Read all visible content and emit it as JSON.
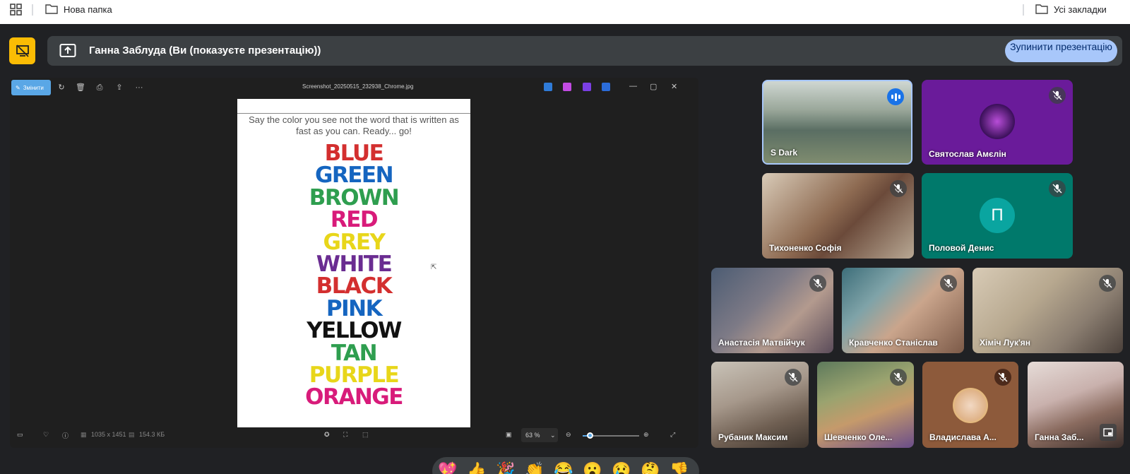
{
  "bookmarks": {
    "folder1": "Нова папка",
    "folder2": "Усі закладки"
  },
  "presentation": {
    "presenter_title": "Ганна Заблуда (Ви (показуєте презентацію))",
    "stop_button": "Зупинити презентацію"
  },
  "viewer": {
    "edit_button": "Змінити",
    "file_name": "Screenshot_20250515_232938_Chrome.jpg",
    "dimensions": "1035 x 1451",
    "file_size": "154.3 КБ",
    "zoom": "63 %",
    "more": "···",
    "minimize": "—",
    "maximize": "▢",
    "close": "✕"
  },
  "document": {
    "instruction": "Say the color you see not the word that is written as fast as you can. Ready... go!",
    "words": [
      {
        "text": "BLUE",
        "color": "#d32f2f"
      },
      {
        "text": "GREEN",
        "color": "#1565c0"
      },
      {
        "text": "BROWN",
        "color": "#2e9e4f"
      },
      {
        "text": "RED",
        "color": "#d81b7a"
      },
      {
        "text": "GREY",
        "color": "#e8d61a"
      },
      {
        "text": "WHITE",
        "color": "#6a2c91"
      },
      {
        "text": "BLACK",
        "color": "#d32f2f"
      },
      {
        "text": "PINK",
        "color": "#1565c0"
      },
      {
        "text": "YELLOW",
        "color": "#111111"
      },
      {
        "text": "TAN",
        "color": "#2e9e4f"
      },
      {
        "text": "PURPLE",
        "color": "#e8d61a"
      },
      {
        "text": "ORANGE",
        "color": "#d81b7a"
      }
    ]
  },
  "participants": [
    {
      "name": "S Dark",
      "muted": false,
      "speaking": true
    },
    {
      "name": "Святослав Амєлін",
      "muted": true
    },
    {
      "name": "Тихоненко Софія",
      "muted": true
    },
    {
      "name": "Половой Денис",
      "muted": true,
      "initial": "П"
    },
    {
      "name": "Анастасія Матвійчук",
      "muted": true
    },
    {
      "name": "Кравченко Станіслав",
      "muted": true
    },
    {
      "name": "Хіміч Лук'ян",
      "muted": true
    },
    {
      "name": "Рубаник Максим",
      "muted": true
    },
    {
      "name": "Шевченко Оле...",
      "muted": true
    },
    {
      "name": "Владислава А...",
      "muted": true
    },
    {
      "name": "Ганна Заб...",
      "muted": false
    }
  ],
  "reactions": [
    "💖",
    "👍",
    "🎉",
    "👏",
    "😂",
    "😮",
    "😢",
    "🤔",
    "👎"
  ],
  "colors": {
    "accent_blue": "#a8c7fa",
    "present_yellow": "#fbbc04",
    "bar_bg": "#3c4043",
    "page_bg": "#202124"
  }
}
